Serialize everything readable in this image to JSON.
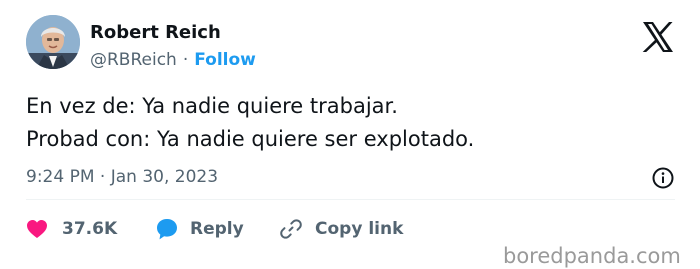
{
  "tweet": {
    "author": {
      "name": "Robert Reich",
      "handle": "@RBReich"
    },
    "separator": "·",
    "follow_label": "Follow",
    "text_lines": [
      "En vez de: Ya nadie quiere trabajar.",
      "Probad con: Ya nadie quiere ser explotado."
    ],
    "timestamp": "9:24 PM · Jan 30, 2023",
    "actions": {
      "like_count": "37.6K",
      "reply_label": "Reply",
      "copy_link_label": "Copy link"
    }
  },
  "icons": {
    "logo": "x-logo-icon",
    "info": "info-icon",
    "like": "heart-icon",
    "reply": "speech-bubble-icon",
    "copy": "link-icon"
  },
  "colors": {
    "accent": "#1d9bf0",
    "like": "#f91880",
    "muted_text": "#536471",
    "text": "#0f1419"
  },
  "watermark": "boredpanda.com"
}
